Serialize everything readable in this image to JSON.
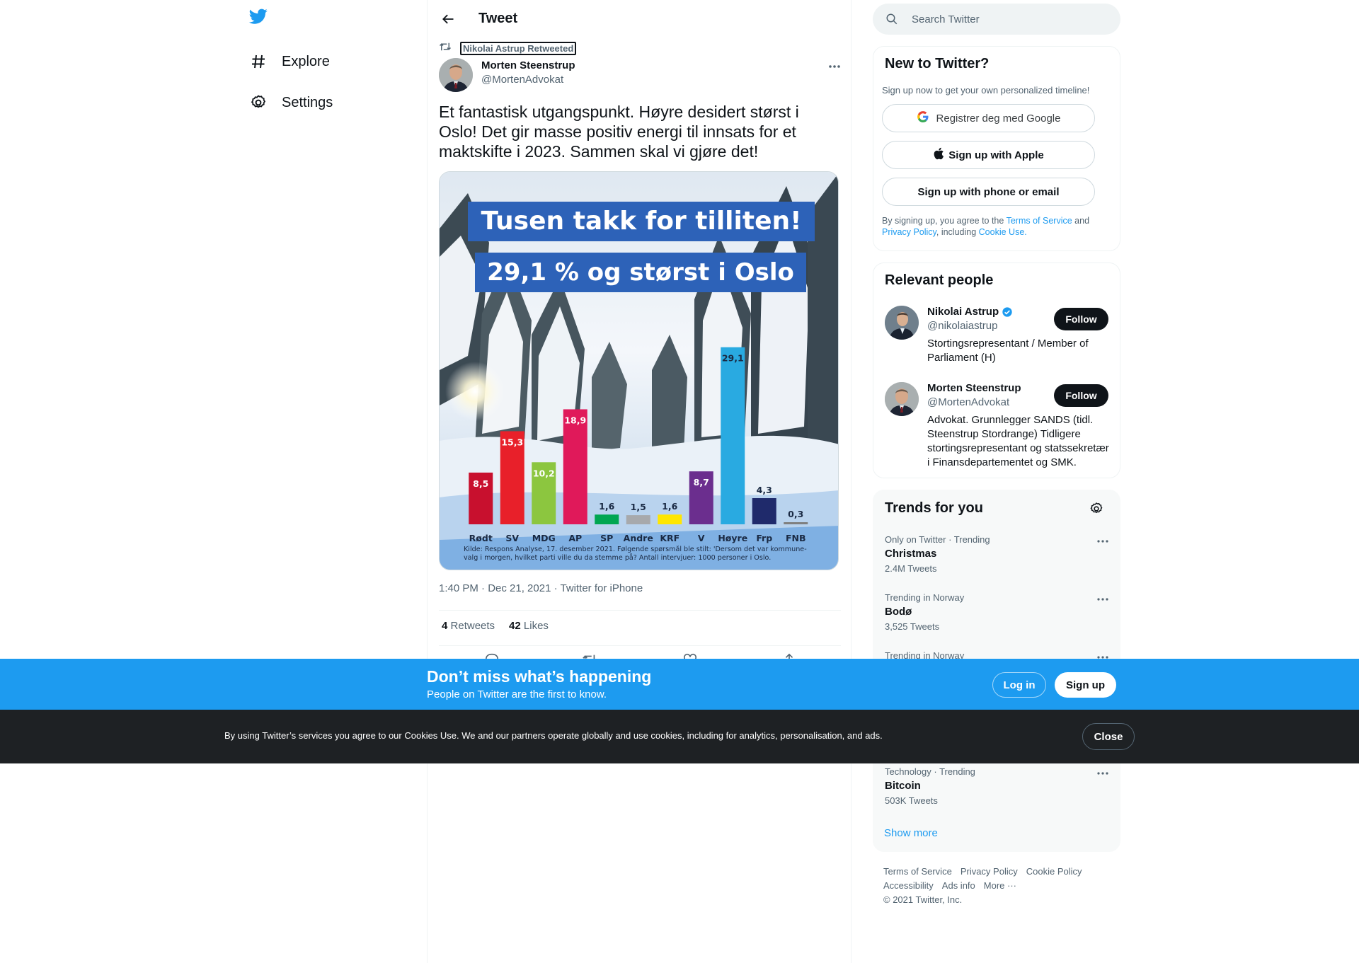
{
  "nav": {
    "logo_icon": "twitter-bird-icon",
    "items": [
      {
        "label": "Explore",
        "icon": "hashtag-icon"
      },
      {
        "label": "Settings",
        "icon": "gear-icon"
      }
    ]
  },
  "header": {
    "title": "Tweet",
    "back_icon": "arrow-left-icon"
  },
  "tweet": {
    "retweeted_by": "Nikolai Astrup Retweeted",
    "author_name": "Morten Steenstrup",
    "author_handle": "@MortenAdvokat",
    "text": "Et fantastisk utgangspunkt. Høyre desidert størst i Oslo! Det gir masse positiv energi til innsats for et maktskifte i 2023. Sammen skal vi gjøre det!",
    "meta": "1:40 PM · Dec 21, 2021 · Twitter for iPhone",
    "retweets_count": "4",
    "retweets_label": "Retweets",
    "likes_count": "42",
    "likes_label": "Likes"
  },
  "media": {
    "banner1": "Tusen takk for tilliten!",
    "banner2": "29,1 % og størst i Oslo",
    "source": "Kilde: Respons Analyse, 17. desember 2021. Følgende spørsmål ble stilt: 'Dersom det var kommune-valg i morgen, hvilket parti ville du da stemme på? Antall intervjuer: 1000 personer i Oslo."
  },
  "chart_data": {
    "type": "bar",
    "categories": [
      "Rødt",
      "SV",
      "MDG",
      "AP",
      "SP",
      "Andre",
      "KRF",
      "V",
      "Høyre",
      "Frp",
      "FNB"
    ],
    "values": [
      8.5,
      15.3,
      10.2,
      18.9,
      1.6,
      1.5,
      1.6,
      8.7,
      29.1,
      4.3,
      0.3
    ],
    "value_labels": [
      "8,5",
      "15,3",
      "10,2",
      "18,9",
      "1,6",
      "1,5",
      "1,6",
      "8,7",
      "29,1",
      "4,3",
      "0,3"
    ],
    "colors": [
      "#c8102e",
      "#e8202a",
      "#8cc63f",
      "#e0195a",
      "#00a651",
      "#a7a9ac",
      "#ffe600",
      "#6b2e8e",
      "#29aae1",
      "#1f2a6b",
      "#7f7f7f"
    ],
    "title": "",
    "xlabel": "",
    "ylabel": "",
    "ylim": [
      0,
      30
    ]
  },
  "search": {
    "placeholder": "Search Twitter"
  },
  "signup": {
    "title": "New to Twitter?",
    "subtitle": "Sign up now to get your own personalized timeline!",
    "google_label": "Registrer deg med Google",
    "apple_label": "Sign up with Apple",
    "phone_label": "Sign up with phone or email",
    "legal_prefix": "By signing up, you agree to the",
    "terms": "Terms of Service",
    "and": "and",
    "privacy": "Privacy Policy",
    "including": ", including",
    "cookie": "Cookie Use."
  },
  "relevant": {
    "title": "Relevant people",
    "people": [
      {
        "name": "Nikolai Astrup",
        "handle": "@nikolaiastrup",
        "bio": "Stortingsrepresentant / Member of Parliament (H)",
        "follow": "Follow"
      },
      {
        "name": "Morten Steenstrup",
        "handle": "@MortenAdvokat",
        "bio": "Advokat. Grunnlegger SANDS (tidl. Steenstrup Stordrange) Tidligere stortingsrepresentant og statssekretær i Finansdepartementet og SMK.",
        "follow": "Follow"
      }
    ]
  },
  "trends": {
    "title": "Trends for you",
    "items": [
      {
        "context": "Only on Twitter · Trending",
        "name": "Christmas",
        "count": "2.4M Tweets"
      },
      {
        "context": "Trending in Norway",
        "name": "Bodø",
        "count": "3,525 Tweets"
      },
      {
        "context": "Trending in Norway",
        "name": "",
        "count": ""
      },
      {
        "context": "Technology · Trending",
        "name": "Bitcoin",
        "count": "503K Tweets"
      }
    ],
    "show_more": "Show more"
  },
  "footer": {
    "links": [
      "Terms of Service",
      "Privacy Policy",
      "Cookie Policy",
      "Accessibility",
      "Ads info",
      "More ···"
    ],
    "copyright": "© 2021 Twitter, Inc."
  },
  "banner": {
    "title": "Don’t miss what’s happening",
    "subtitle": "People on Twitter are the first to know.",
    "login": "Log in",
    "signup": "Sign up"
  },
  "cookies": {
    "text": "By using Twitter’s services you agree to our Cookies Use. We and our partners operate globally and use cookies, including for analytics, personalisation, and ads.",
    "close": "Close"
  },
  "colors": {
    "accent": "#1d9bf0",
    "text": "#0f1419",
    "muted": "#536471",
    "cookie_bg": "#1e2124"
  }
}
